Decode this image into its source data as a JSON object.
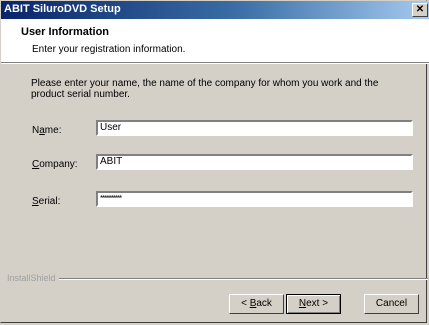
{
  "window": {
    "title": "ABIT SiluroDVD Setup",
    "close_glyph": "✕"
  },
  "header": {
    "title": "User Information",
    "subtitle": "Enter your registration information."
  },
  "main": {
    "instructions": "Please enter your name, the name of the company for whom you work and the product serial number.",
    "fields": {
      "name": {
        "label_access": "a",
        "label_pre": "N",
        "label_post": "me:",
        "value": "User"
      },
      "company": {
        "label_access": "C",
        "label_pre": "",
        "label_post": "ompany:",
        "value": "ABIT"
      },
      "serial": {
        "label_access": "S",
        "label_pre": "",
        "label_post": "erial:",
        "value": "**********"
      }
    }
  },
  "footer": {
    "brand": "InstallShield",
    "back": {
      "pre": "< ",
      "access": "B",
      "post": "ack"
    },
    "next": {
      "pre": "",
      "access": "N",
      "post": "ext >"
    },
    "cancel_label": "Cancel"
  }
}
